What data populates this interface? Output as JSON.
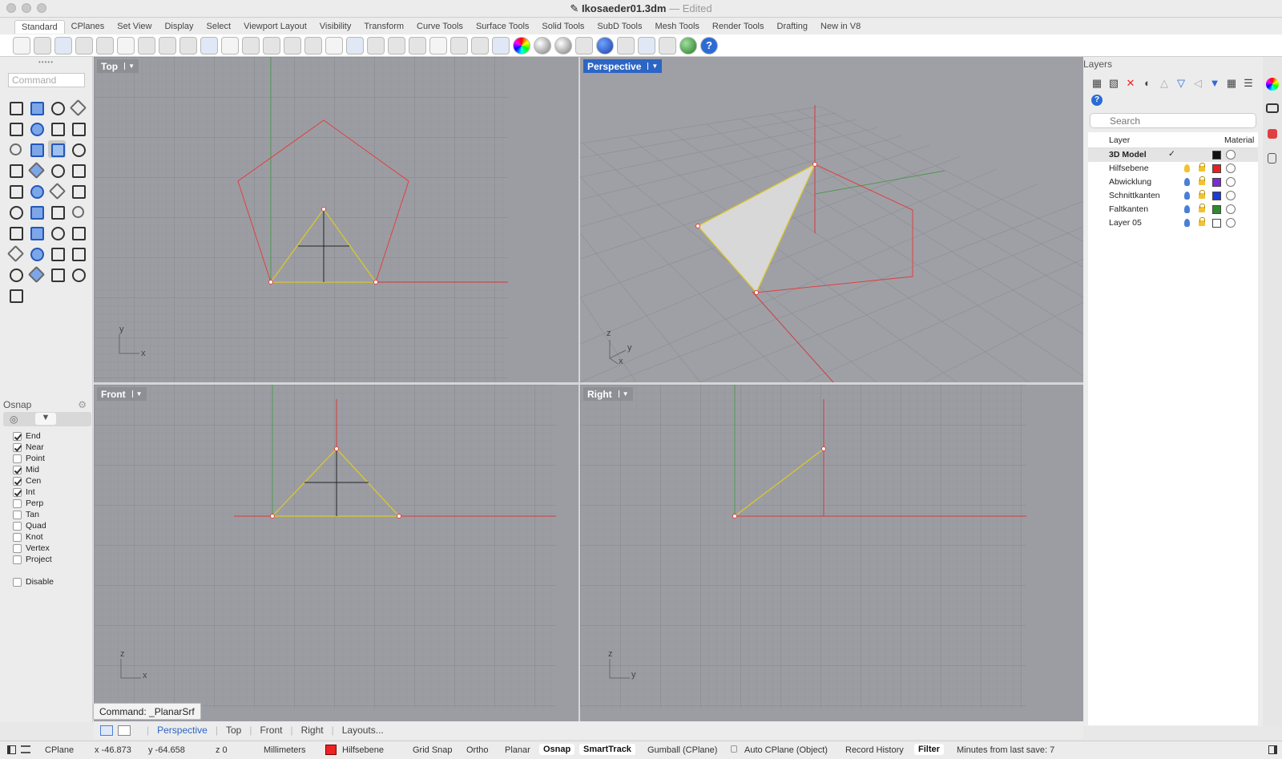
{
  "window": {
    "title": "Ikosaeder01.3dm",
    "separator": " — ",
    "state": "Edited"
  },
  "tabs": [
    "Standard",
    "CPlanes",
    "Set View",
    "Display",
    "Select",
    "Viewport Layout",
    "Visibility",
    "Transform",
    "Curve Tools",
    "Surface Tools",
    "Solid Tools",
    "SubD Tools",
    "Mesh Tools",
    "Render Tools",
    "Drafting",
    "New in V8"
  ],
  "active_tab": "Standard",
  "toolbar_icons": [
    "new-file-icon",
    "open-file-icon",
    "save-icon",
    "print-icon",
    "import-icon",
    "cut-icon",
    "copy-icon",
    "paste-icon",
    "undo-icon",
    "pan-hand-icon",
    "move-view-icon",
    "zoom-icon",
    "zoom-window-icon",
    "zoom-extents-icon",
    "zoom-selected-icon",
    "rotate-view-icon",
    "four-viewports-icon",
    "car-icon",
    "grid-icon",
    "cplane-icon",
    "points-icon",
    "light-icon",
    "lock-icon",
    "layer-icon",
    "color-wheel-icon",
    "sphere-gray-icon",
    "sphere-dark-icon",
    "render-grid-icon",
    "render-sphere-icon",
    "flag-icon",
    "gears-icon",
    "dimension-icon",
    "globe-icon",
    "help-icon"
  ],
  "command": {
    "placeholder": "Command",
    "prompt": "Command: _PlanarSrf"
  },
  "viewports": {
    "top": {
      "label": "Top",
      "axis_a": "y",
      "axis_b": "x"
    },
    "perspective": {
      "label": "Perspective",
      "axis_a": "z",
      "axis_b": "y",
      "axis_c": "x"
    },
    "front": {
      "label": "Front",
      "axis_a": "z",
      "axis_b": "x"
    },
    "right": {
      "label": "Right",
      "axis_a": "z",
      "axis_b": "y"
    }
  },
  "osnap": {
    "title": "Osnap",
    "items": [
      {
        "label": "End",
        "checked": true
      },
      {
        "label": "Near",
        "checked": true
      },
      {
        "label": "Point",
        "checked": false
      },
      {
        "label": "Mid",
        "checked": true
      },
      {
        "label": "Cen",
        "checked": true
      },
      {
        "label": "Int",
        "checked": true
      },
      {
        "label": "Perp",
        "checked": false
      },
      {
        "label": "Tan",
        "checked": false
      },
      {
        "label": "Quad",
        "checked": false
      },
      {
        "label": "Knot",
        "checked": false
      },
      {
        "label": "Vertex",
        "checked": false
      },
      {
        "label": "Project",
        "checked": false
      }
    ],
    "disable": {
      "label": "Disable",
      "checked": false
    }
  },
  "layers": {
    "title": "Layers",
    "search_placeholder": "Search",
    "col_layer": "Layer",
    "col_material": "Material",
    "rows": [
      {
        "name": "3D Model",
        "current": true,
        "color": "#111111"
      },
      {
        "name": "Hilfsebene",
        "current": false,
        "color": "#e82020"
      },
      {
        "name": "Abwicklung",
        "current": false,
        "color": "#7b2cd6"
      },
      {
        "name": "Schnittkanten",
        "current": false,
        "color": "#1f3bd6"
      },
      {
        "name": "Faltkanten",
        "current": false,
        "color": "#2f8a2f"
      },
      {
        "name": "Layer 05",
        "current": false,
        "color": "#ffffff"
      }
    ]
  },
  "viewport_tabs": [
    "Perspective",
    "Top",
    "Front",
    "Right",
    "Layouts..."
  ],
  "active_viewport_tab": "Perspective",
  "status": {
    "cplane": "CPlane",
    "x": "x -46.873",
    "y": "y -64.658",
    "z": "z 0",
    "units": "Millimeters",
    "layer": "Hilfsebene",
    "grid_snap": "Grid Snap",
    "ortho": "Ortho",
    "planar": "Planar",
    "osnap": "Osnap",
    "smarttrack": "SmartTrack",
    "gumball": "Gumball (CPlane)",
    "auto_cplane": "Auto CPlane (Object)",
    "record_history": "Record History",
    "filter": "Filter",
    "save_info": "Minutes from last save: 7"
  }
}
